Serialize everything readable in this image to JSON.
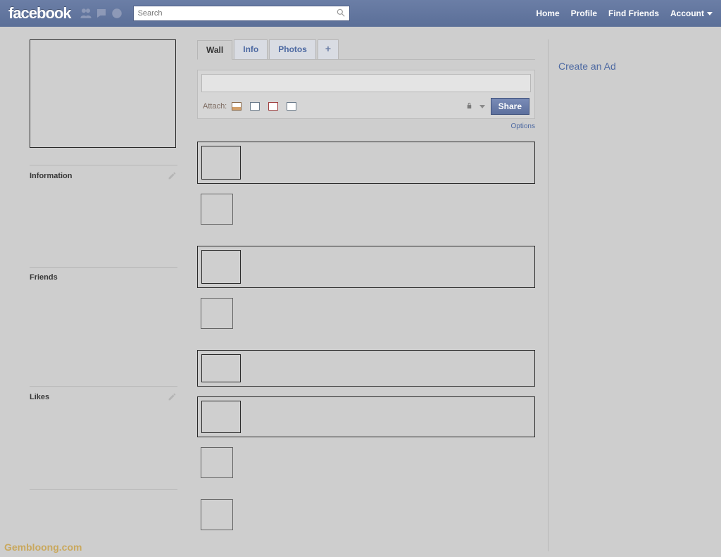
{
  "brand": "facebook",
  "search": {
    "placeholder": "Search"
  },
  "nav": {
    "home": "Home",
    "profile": "Profile",
    "find_friends": "Find Friends",
    "account": "Account"
  },
  "sidebar": {
    "information": {
      "title": "Information"
    },
    "friends": {
      "title": "Friends"
    },
    "likes": {
      "title": "Likes"
    }
  },
  "tabs": {
    "wall": "Wall",
    "info": "Info",
    "photos": "Photos",
    "add": "+"
  },
  "composer": {
    "attach_label": "Attach:",
    "share_label": "Share"
  },
  "options_link": "Options",
  "right": {
    "create_ad": "Create an Ad"
  },
  "watermark": "Gembloong.com"
}
